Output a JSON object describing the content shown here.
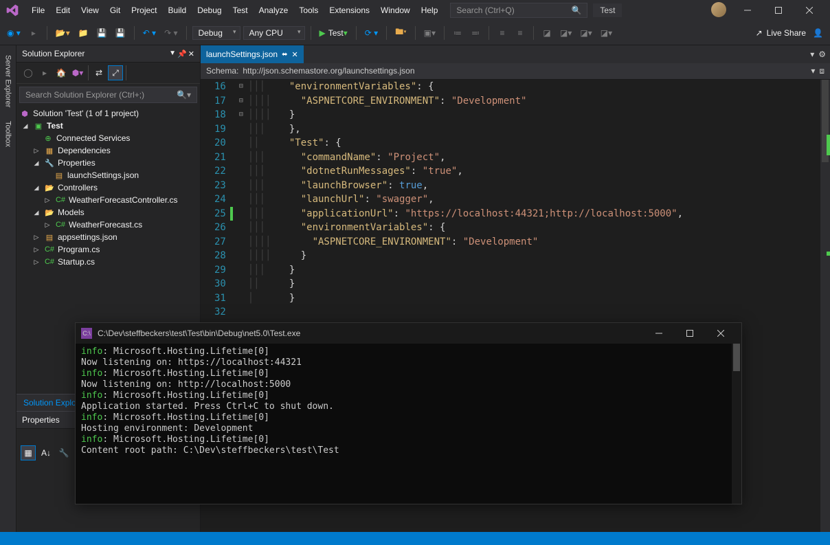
{
  "menu": [
    "File",
    "Edit",
    "View",
    "Git",
    "Project",
    "Build",
    "Debug",
    "Test",
    "Analyze",
    "Tools",
    "Extensions",
    "Window",
    "Help"
  ],
  "search_placeholder": "Search (Ctrl+Q)",
  "titlebar_app": "Test",
  "toolbar": {
    "config": "Debug",
    "platform": "Any CPU",
    "run_label": "Test",
    "live_share": "Live Share"
  },
  "side_tabs": [
    "Server Explorer",
    "Toolbox"
  ],
  "solution_explorer": {
    "title": "Solution Explorer",
    "search_placeholder": "Search Solution Explorer (Ctrl+;)",
    "root": "Solution 'Test' (1 of 1 project)",
    "project": "Test",
    "nodes": {
      "connected": "Connected Services",
      "deps": "Dependencies",
      "props": "Properties",
      "launch": "launchSettings.json",
      "controllers": "Controllers",
      "wfc": "WeatherForecastController.cs",
      "models": "Models",
      "wf": "WeatherForecast.cs",
      "appsettings": "appsettings.json",
      "program": "Program.cs",
      "startup": "Startup.cs"
    },
    "bottom_tab": "Solution Explo"
  },
  "properties": {
    "title": "Properties"
  },
  "editor": {
    "tab_name": "launchSettings.json",
    "schema_label": "Schema:",
    "schema_url": "http://json.schemastore.org/launchsettings.json",
    "lines": [
      {
        "n": 16,
        "fold": "⊟",
        "g": "│││ ",
        "t": [
          [
            "key",
            "\"environmentVariables\""
          ],
          [
            "punc",
            ": {"
          ]
        ]
      },
      {
        "n": 17,
        "g": "││││",
        "t": [
          [
            "punc",
            "  "
          ],
          [
            "key",
            "\"ASPNETCORE_ENVIRONMENT\""
          ],
          [
            "punc",
            ": "
          ],
          [
            "str",
            "\"Development\""
          ]
        ]
      },
      {
        "n": 18,
        "g": "││││",
        "t": [
          [
            "punc",
            "}"
          ]
        ]
      },
      {
        "n": 19,
        "g": "│││ ",
        "t": [
          [
            "punc",
            "},"
          ]
        ],
        "out": -1
      },
      {
        "n": 20,
        "fold": "⊟",
        "g": "││  ",
        "t": [
          [
            "key",
            "\"Test\""
          ],
          [
            "punc",
            ": {"
          ]
        ]
      },
      {
        "n": 21,
        "g": "│││ ",
        "t": [
          [
            "punc",
            "  "
          ],
          [
            "key",
            "\"commandName\""
          ],
          [
            "punc",
            ": "
          ],
          [
            "str",
            "\"Project\""
          ],
          [
            "punc",
            ","
          ]
        ]
      },
      {
        "n": 22,
        "g": "│││ ",
        "t": [
          [
            "punc",
            "  "
          ],
          [
            "key",
            "\"dotnetRunMessages\""
          ],
          [
            "punc",
            ": "
          ],
          [
            "str",
            "\"true\""
          ],
          [
            "punc",
            ","
          ]
        ]
      },
      {
        "n": 23,
        "g": "│││ ",
        "t": [
          [
            "punc",
            "  "
          ],
          [
            "key",
            "\"launchBrowser\""
          ],
          [
            "punc",
            ": "
          ],
          [
            "bool",
            "true"
          ],
          [
            "punc",
            ","
          ]
        ]
      },
      {
        "n": 24,
        "g": "│││ ",
        "t": [
          [
            "punc",
            "  "
          ],
          [
            "key",
            "\"launchUrl\""
          ],
          [
            "punc",
            ": "
          ],
          [
            "str",
            "\"swagger\""
          ],
          [
            "punc",
            ","
          ]
        ]
      },
      {
        "n": 25,
        "g": "│││ ",
        "t": [
          [
            "punc",
            "  "
          ],
          [
            "key",
            "\"applicationUrl\""
          ],
          [
            "punc",
            ": "
          ],
          [
            "str",
            "\"https://localhost:44321;http://localhost:5000\""
          ],
          [
            "punc",
            ","
          ]
        ],
        "mark": true
      },
      {
        "n": 26,
        "fold": "⊟",
        "g": "│││ ",
        "t": [
          [
            "punc",
            "  "
          ],
          [
            "key",
            "\"environmentVariables\""
          ],
          [
            "punc",
            ": {"
          ]
        ]
      },
      {
        "n": 27,
        "g": "││││",
        "t": [
          [
            "punc",
            "    "
          ],
          [
            "key",
            "\"ASPNETCORE_ENVIRONMENT\""
          ],
          [
            "punc",
            ": "
          ],
          [
            "str",
            "\"Development\""
          ]
        ]
      },
      {
        "n": 28,
        "g": "││││",
        "t": [
          [
            "punc",
            "  }"
          ]
        ]
      },
      {
        "n": 29,
        "g": "│││ ",
        "t": [
          [
            "punc",
            "}"
          ]
        ],
        "out": -1
      },
      {
        "n": 30,
        "g": "││  ",
        "t": [
          [
            "punc",
            "}"
          ]
        ],
        "out": -2
      },
      {
        "n": 31,
        "g": "│   ",
        "t": [
          [
            "punc",
            "}"
          ]
        ],
        "out": -3
      },
      {
        "n": 32,
        "g": "    ",
        "t": [
          [
            "punc",
            ""
          ]
        ]
      }
    ]
  },
  "console": {
    "title": "C:\\Dev\\steffbeckers\\test\\Test\\bin\\Debug\\net5.0\\Test.exe",
    "lines": [
      [
        "info",
        ": Microsoft.Hosting.Lifetime[0]"
      ],
      [
        "",
        "      Now listening on: https://localhost:44321"
      ],
      [
        "info",
        ": Microsoft.Hosting.Lifetime[0]"
      ],
      [
        "",
        "      Now listening on: http://localhost:5000"
      ],
      [
        "info",
        ": Microsoft.Hosting.Lifetime[0]"
      ],
      [
        "",
        "      Application started. Press Ctrl+C to shut down."
      ],
      [
        "info",
        ": Microsoft.Hosting.Lifetime[0]"
      ],
      [
        "",
        "      Hosting environment: Development"
      ],
      [
        "info",
        ": Microsoft.Hosting.Lifetime[0]"
      ],
      [
        "",
        "      Content root path: C:\\Dev\\steffbeckers\\test\\Test"
      ]
    ]
  }
}
